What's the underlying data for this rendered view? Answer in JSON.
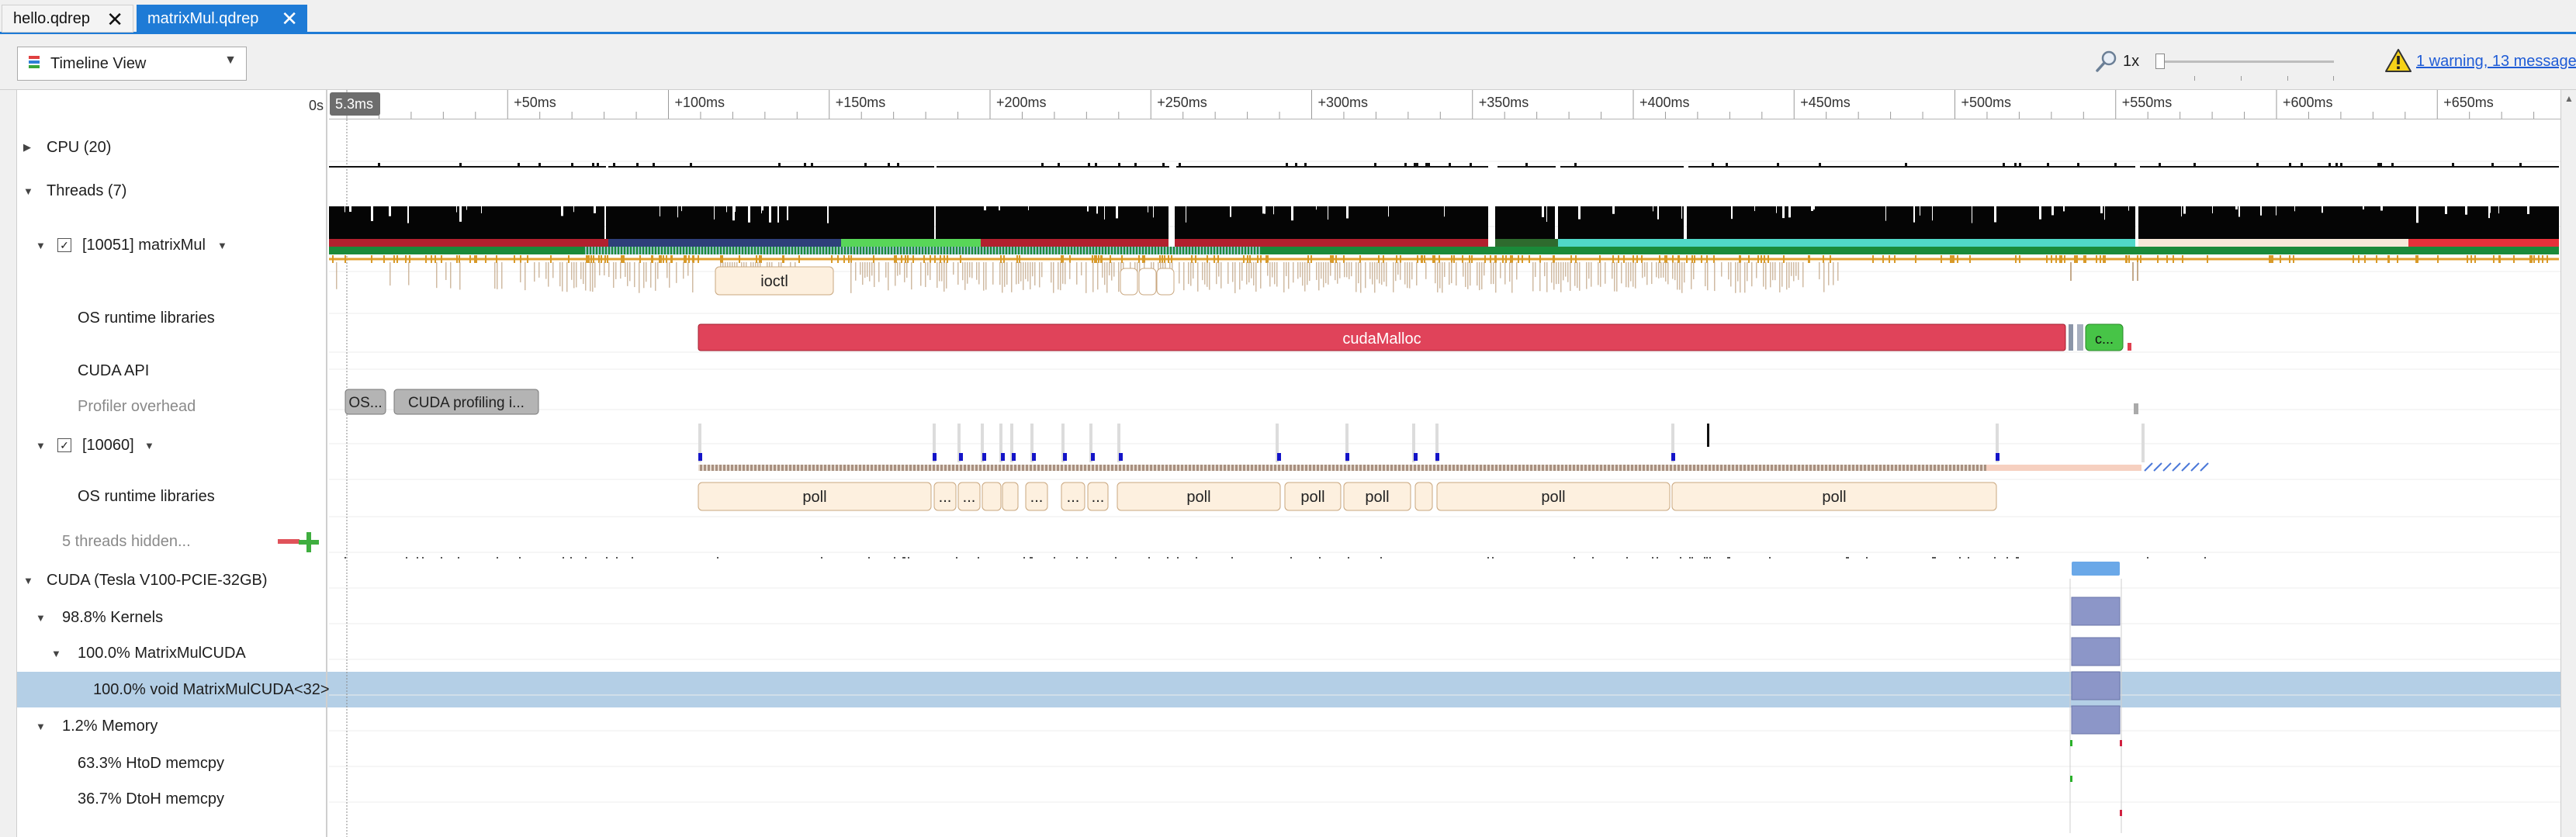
{
  "tabs": [
    {
      "label": "hello.qdrep",
      "active": false
    },
    {
      "label": "matrixMul.qdrep",
      "active": true
    }
  ],
  "toolbar": {
    "view_select": "Timeline View",
    "zoom_level": "1x",
    "warning_link": "1 warning, 13 messages"
  },
  "ruler": {
    "origin_label": "0s",
    "cursor_label": "5.3ms",
    "ticks": [
      "+50ms",
      "+100ms",
      "+150ms",
      "+200ms",
      "+250ms",
      "+300ms",
      "+350ms",
      "+400ms",
      "+450ms",
      "+500ms",
      "+550ms",
      "+600ms",
      "+650ms"
    ]
  },
  "tree": {
    "cpu": "CPU (20)",
    "threads": "Threads (7)",
    "thread_main": "[10051] matrixMul",
    "os_runtime_1": "OS runtime libraries",
    "cuda_api": "CUDA API",
    "profiler_overhead": "Profiler overhead",
    "thread_second": "[10060]",
    "os_runtime_2": "OS runtime libraries",
    "threads_hidden": "5 threads hidden...",
    "cuda_device": "CUDA (Tesla V100-PCIE-32GB)",
    "kernels": "98.8% Kernels",
    "kernel_group": "100.0% MatrixMulCUDA",
    "kernel_item": "100.0% void MatrixMulCUDA<32>",
    "memory": "1.2% Memory",
    "htod": "63.3% HtoD memcpy",
    "dtoh": "36.7% DtoH memcpy"
  },
  "events": {
    "ioctl": "ioctl",
    "cuda_malloc": "cudaMalloc",
    "cuda_small": "c...",
    "os_overhead": "OS...",
    "cuda_profiling": "CUDA profiling i...",
    "poll": "poll",
    "ellipsis": "..."
  },
  "colors": {
    "accent": "#1e7bd6",
    "selection": "#b4cfe6",
    "cuda_malloc": "#e0435a",
    "cuda_green": "#47c447",
    "os_event_fill": "#fdf0df",
    "os_event_border": "#c9a77f",
    "kernel": "#8c96c8",
    "kernel_top": "#6aa8e8"
  }
}
